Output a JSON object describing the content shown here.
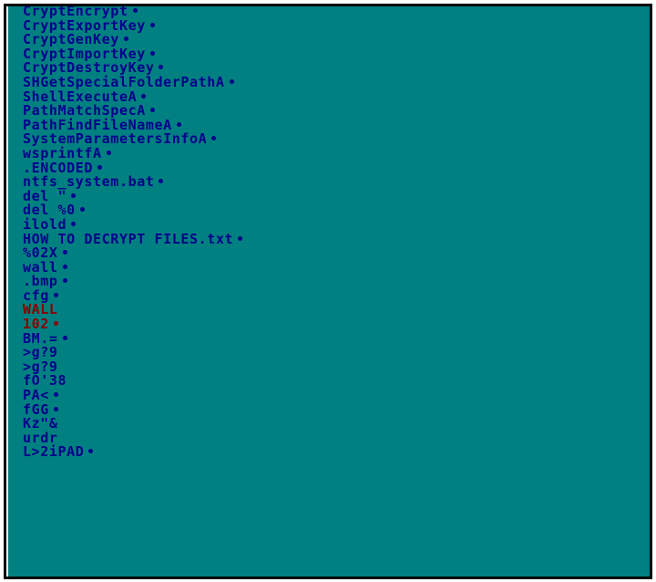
{
  "colors": {
    "background": "#008080",
    "text_default": "#00008b",
    "text_highlight": "#8b0000",
    "frame_border": "#000000"
  },
  "strings": [
    {
      "text": "CryptEncrypt",
      "marker": true,
      "color": "blue"
    },
    {
      "text": "CryptExportKey",
      "marker": true,
      "color": "blue"
    },
    {
      "text": "CryptGenKey",
      "marker": true,
      "color": "blue"
    },
    {
      "text": "CryptImportKey",
      "marker": true,
      "color": "blue"
    },
    {
      "text": "CryptDestroyKey",
      "marker": true,
      "color": "blue"
    },
    {
      "text": "SHGetSpecialFolderPathA",
      "marker": true,
      "color": "blue"
    },
    {
      "text": "ShellExecuteA",
      "marker": true,
      "color": "blue"
    },
    {
      "text": "PathMatchSpecA",
      "marker": true,
      "color": "blue"
    },
    {
      "text": "PathFindFileNameA",
      "marker": true,
      "color": "blue"
    },
    {
      "text": "SystemParametersInfoA",
      "marker": true,
      "color": "blue"
    },
    {
      "text": "wsprintfA",
      "marker": true,
      "color": "blue"
    },
    {
      "text": ".ENCODED",
      "marker": true,
      "color": "blue"
    },
    {
      "text": "ntfs_system.bat",
      "marker": true,
      "color": "blue"
    },
    {
      "text": "del \"",
      "marker": true,
      "color": "blue"
    },
    {
      "text": "del %0",
      "marker": true,
      "color": "blue"
    },
    {
      "text": "ilold",
      "marker": true,
      "color": "blue"
    },
    {
      "text": "HOW TO DECRYPT FILES.txt",
      "marker": true,
      "color": "blue"
    },
    {
      "text": "%02X",
      "marker": true,
      "color": "blue"
    },
    {
      "text": "wall",
      "marker": true,
      "color": "blue"
    },
    {
      "text": ".bmp",
      "marker": true,
      "color": "blue"
    },
    {
      "text": "cfg",
      "marker": true,
      "color": "blue"
    },
    {
      "text": "WALL",
      "marker": false,
      "color": "red"
    },
    {
      "text": "102",
      "marker": true,
      "color": "red"
    },
    {
      "text": "BM.=",
      "marker": true,
      "color": "blue"
    },
    {
      "text": ">g?9",
      "marker": false,
      "color": "blue"
    },
    {
      "text": ">g?9",
      "marker": false,
      "color": "blue"
    },
    {
      "text": "fO'38",
      "marker": false,
      "color": "blue"
    },
    {
      "text": "PA<",
      "marker": true,
      "color": "blue"
    },
    {
      "text": "fGG",
      "marker": true,
      "color": "blue"
    },
    {
      "text": "Kz\"&",
      "marker": false,
      "color": "blue"
    },
    {
      "text": "urdr",
      "marker": false,
      "color": "blue"
    },
    {
      "text": "L>2iPAD",
      "marker": true,
      "color": "blue"
    }
  ]
}
